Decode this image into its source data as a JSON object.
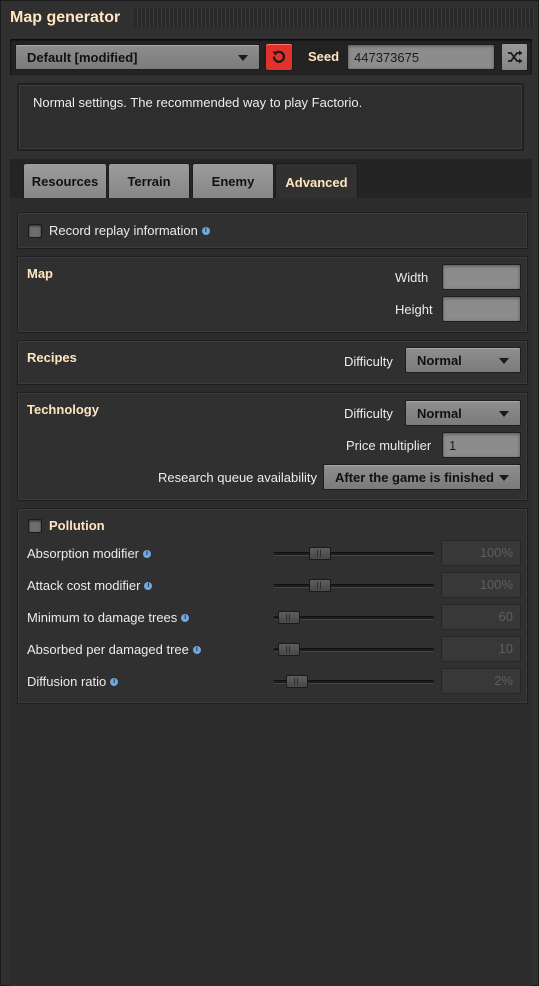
{
  "window": {
    "title": "Map generator"
  },
  "preset": {
    "selected": "Default [modified]"
  },
  "seed": {
    "label": "Seed",
    "value": "447373675"
  },
  "description": "Normal settings. The recommended way to play Factorio.",
  "tabs": [
    {
      "label": "Resources"
    },
    {
      "label": "Terrain"
    },
    {
      "label": "Enemy"
    },
    {
      "label": "Advanced"
    }
  ],
  "replay": {
    "label": "Record replay information",
    "checked": false
  },
  "map": {
    "title": "Map",
    "width_label": "Width",
    "width_value": "",
    "height_label": "Height",
    "height_value": ""
  },
  "recipes": {
    "title": "Recipes",
    "difficulty_label": "Difficulty",
    "difficulty_value": "Normal"
  },
  "technology": {
    "title": "Technology",
    "difficulty_label": "Difficulty",
    "difficulty_value": "Normal",
    "price_label": "Price multiplier",
    "price_value": "1",
    "queue_label": "Research queue availability",
    "queue_value": "After the game is finished"
  },
  "pollution": {
    "title": "Pollution",
    "enabled": false,
    "rows": [
      {
        "label": "Absorption modifier",
        "value": "100%",
        "level": 0.25
      },
      {
        "label": "Attack cost modifier",
        "value": "100%",
        "level": 0.25
      },
      {
        "label": "Minimum to damage trees",
        "value": "60",
        "level": 0.03
      },
      {
        "label": "Absorbed per damaged tree",
        "value": "10",
        "level": 0.03
      },
      {
        "label": "Diffusion ratio",
        "value": "2%",
        "level": 0.09
      }
    ]
  },
  "colors": {
    "accent_title": "#ffe6c0",
    "reset_button": "#e3312b",
    "info_icon": "#6fa8dc"
  },
  "icons": {
    "reset": "reset-arrow-icon",
    "shuffle": "shuffle-icon",
    "info": "info-icon",
    "dropdown": "chevron-down-icon"
  }
}
